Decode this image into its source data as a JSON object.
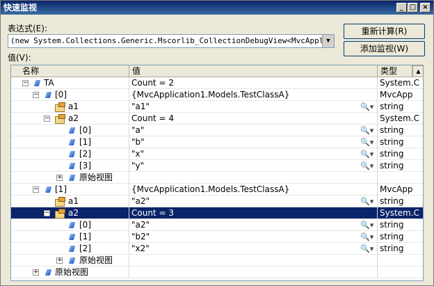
{
  "window": {
    "title": "快速监视"
  },
  "labels": {
    "expression": "表达式(E):",
    "value": "值(V):"
  },
  "expression": {
    "value": "(new System.Collections.Generic.Mscorlib_CollectionDebugView<MvcApplicatio"
  },
  "buttons": {
    "recalc": "重新计算(R)",
    "add_watch": "添加监视(W)"
  },
  "columns": {
    "name": "名称",
    "value": "值",
    "type": "类型"
  },
  "rows": [
    {
      "name": "TA",
      "value": "Count = 2",
      "type": "System.C"
    },
    {
      "name": "[0]",
      "value": "{MvcApplication1.Models.TestClassA}",
      "type": "MvcApp"
    },
    {
      "name": "a1",
      "value": "\"a1\"",
      "type": "string"
    },
    {
      "name": "a2",
      "value": "Count = 4",
      "type": "System.C"
    },
    {
      "name": "[0]",
      "value": "\"a\"",
      "type": "string"
    },
    {
      "name": "[1]",
      "value": "\"b\"",
      "type": "string"
    },
    {
      "name": "[2]",
      "value": "\"x\"",
      "type": "string"
    },
    {
      "name": "[3]",
      "value": "\"y\"",
      "type": "string"
    },
    {
      "name": "原始视图",
      "value": "",
      "type": ""
    },
    {
      "name": "[1]",
      "value": "{MvcApplication1.Models.TestClassA}",
      "type": "MvcApp"
    },
    {
      "name": "a1",
      "value": "\"a2\"",
      "type": "string"
    },
    {
      "name": "a2",
      "value": "Count = 3",
      "type": "System.C"
    },
    {
      "name": "[0]",
      "value": "\"a2\"",
      "type": "string"
    },
    {
      "name": "[1]",
      "value": "\"b2\"",
      "type": "string"
    },
    {
      "name": "[2]",
      "value": "\"x2\"",
      "type": "string"
    },
    {
      "name": "原始视图",
      "value": "",
      "type": ""
    },
    {
      "name": "原始视图",
      "value": "",
      "type": ""
    }
  ]
}
